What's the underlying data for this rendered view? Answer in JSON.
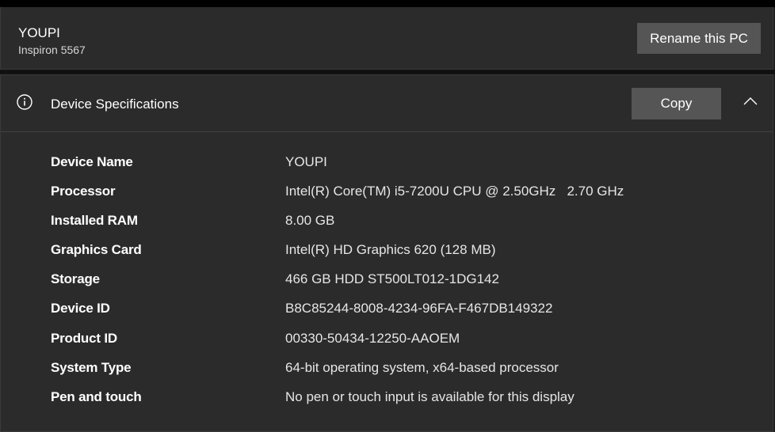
{
  "pc": {
    "name": "YOUPI",
    "model": "Inspiron 5567",
    "rename_label": "Rename this PC"
  },
  "device_specs": {
    "title": "Device Specifications",
    "info_icon": "info-circle-icon",
    "copy_label": "Copy",
    "collapse_icon": "chevron-up-icon",
    "rows": [
      {
        "label": "Device Name",
        "value": "YOUPI"
      },
      {
        "label": "Processor",
        "value": "Intel(R) Core(TM) i5-7200U CPU @ 2.50GHz   2.70 GHz"
      },
      {
        "label": "Installed RAM",
        "value": "8.00 GB"
      },
      {
        "label": "Graphics Card",
        "value": "Intel(R) HD Graphics 620 (128 MB)"
      },
      {
        "label": "Storage",
        "value": "466 GB HDD ST500LT012-1DG142"
      },
      {
        "label": "Device ID",
        "value": "B8C85244-8008-4234-96FA-F467DB149322"
      },
      {
        "label": "Product ID",
        "value": "00330-50434-12250-AAOEM"
      },
      {
        "label": "System Type",
        "value": "64-bit operating system, x64-based processor"
      },
      {
        "label": "Pen and touch",
        "value": "No pen or touch input is available for this display"
      }
    ]
  },
  "colors": {
    "background": "#1f1f1f",
    "card": "#2b2b2b",
    "button": "#555555",
    "text": "#ffffff"
  }
}
